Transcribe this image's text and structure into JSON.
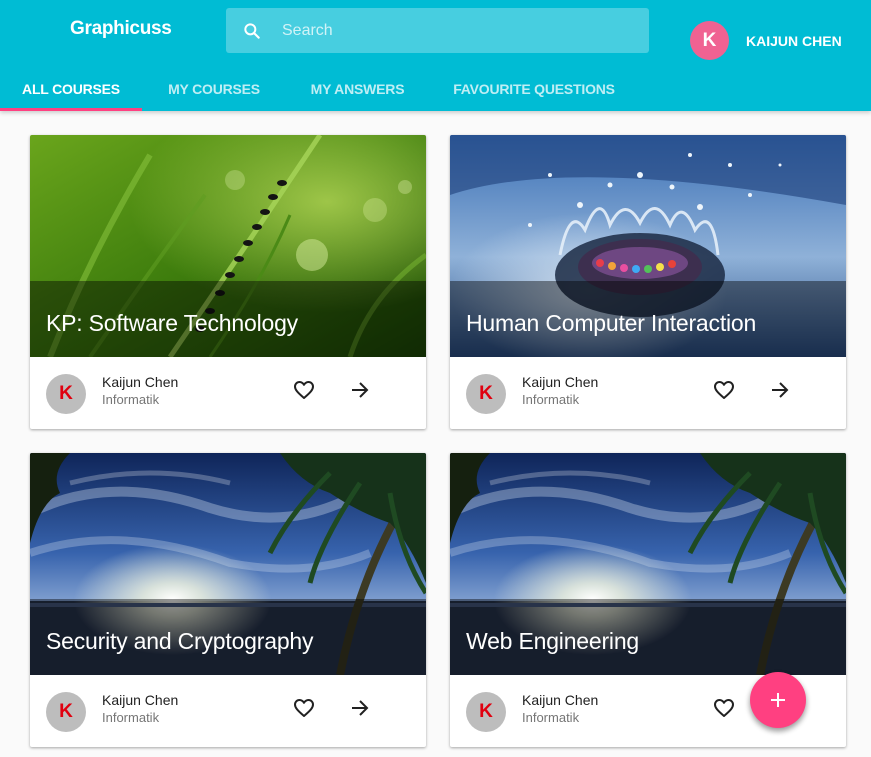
{
  "app": {
    "title": "Graphicuss"
  },
  "search": {
    "placeholder": "Search"
  },
  "user": {
    "initial": "K",
    "name": "KAIJUN CHEN"
  },
  "tabs": [
    {
      "label": "ALL COURSES",
      "active": true
    },
    {
      "label": "MY COURSES",
      "active": false
    },
    {
      "label": "MY ANSWERS",
      "active": false
    },
    {
      "label": "FAVOURITE QUESTIONS",
      "active": false
    }
  ],
  "courses": [
    {
      "title": "KP: Software Technology",
      "author_initial": "K",
      "author": "Kaijun Chen",
      "department": "Informatik"
    },
    {
      "title": "Human Computer Interaction",
      "author_initial": "K",
      "author": "Kaijun Chen",
      "department": "Informatik"
    },
    {
      "title": "Security and Cryptography",
      "author_initial": "K",
      "author": "Kaijun Chen",
      "department": "Informatik"
    },
    {
      "title": "Web Engineering",
      "author_initial": "K",
      "author": "Kaijun Chen",
      "department": "Informatik"
    }
  ],
  "icons": {
    "search": "search-icon",
    "favorite": "heart-outline-icon",
    "open": "arrow-right-icon",
    "add": "plus-icon"
  },
  "colors": {
    "primary": "#00bcd4",
    "accent": "#ff4081",
    "avatar": "#f06292"
  }
}
